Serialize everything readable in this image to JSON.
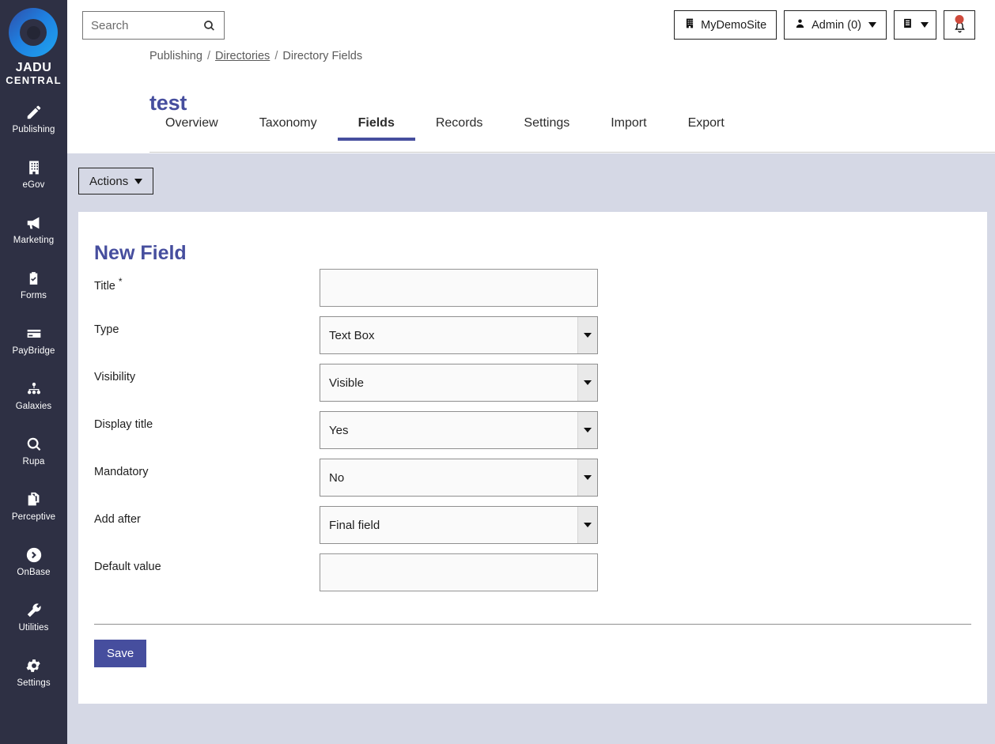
{
  "brand": {
    "name_line1": "JADU",
    "name_line2": "CENTRAL",
    "logo_color": "#1f7fe0",
    "sidebar_bg": "#2e3044"
  },
  "sidebar": {
    "items": [
      {
        "label": "Publishing",
        "icon": "pencil-icon"
      },
      {
        "label": "eGov",
        "icon": "building-icon"
      },
      {
        "label": "Marketing",
        "icon": "megaphone-icon"
      },
      {
        "label": "Forms",
        "icon": "clipboard-check-icon"
      },
      {
        "label": "PayBridge",
        "icon": "credit-card-icon"
      },
      {
        "label": "Galaxies",
        "icon": "sitemap-icon"
      },
      {
        "label": "Rupa",
        "icon": "magnifier-icon"
      },
      {
        "label": "Perceptive",
        "icon": "copy-documents-icon"
      },
      {
        "label": "OnBase",
        "icon": "circle-arrow-right-icon"
      },
      {
        "label": "Utilities",
        "icon": "wrench-icon"
      },
      {
        "label": "Settings",
        "icon": "gear-icon"
      }
    ]
  },
  "header": {
    "search": {
      "value": "",
      "placeholder": "Search"
    },
    "site_button": {
      "label": "MyDemoSite",
      "icon": "building-icon"
    },
    "user_button": {
      "label": "Admin (0)",
      "icon": "person-icon"
    },
    "docs_button": {
      "label": "",
      "icon": "book-icon"
    },
    "notification_button": {
      "label": "",
      "icon": "bell-icon",
      "badge_color": "#cf4a3c"
    }
  },
  "breadcrumb": {
    "item1": "Publishing",
    "item2": "Directories",
    "item3": "Directory Fields",
    "separator": "/"
  },
  "page": {
    "title": "test",
    "title_color": "#464e9e"
  },
  "tabs": [
    {
      "label": "Overview",
      "active": false
    },
    {
      "label": "Taxonomy",
      "active": false
    },
    {
      "label": "Fields",
      "active": true
    },
    {
      "label": "Records",
      "active": false
    },
    {
      "label": "Settings",
      "active": false
    },
    {
      "label": "Import",
      "active": false
    },
    {
      "label": "Export",
      "active": false
    }
  ],
  "toolbar": {
    "actions_label": "Actions"
  },
  "card": {
    "heading": "New Field",
    "fields": [
      {
        "label": "Title",
        "required": true,
        "control": "text",
        "value": ""
      },
      {
        "label": "Type",
        "required": false,
        "control": "select",
        "value": "Text Box"
      },
      {
        "label": "Visibility",
        "required": false,
        "control": "select",
        "value": "Visible"
      },
      {
        "label": "Display title",
        "required": false,
        "control": "select",
        "value": "Yes"
      },
      {
        "label": "Mandatory",
        "required": false,
        "control": "select",
        "value": "No"
      },
      {
        "label": "Add after",
        "required": false,
        "control": "select",
        "value": "Final field"
      },
      {
        "label": "Default value",
        "required": false,
        "control": "text",
        "value": ""
      }
    ],
    "required_marker": "*",
    "save_label": "Save",
    "save_color": "#464e9e"
  },
  "colors": {
    "page_bg": "#d5d8e5",
    "card_bg": "#ffffff",
    "accent": "#464e9e"
  }
}
